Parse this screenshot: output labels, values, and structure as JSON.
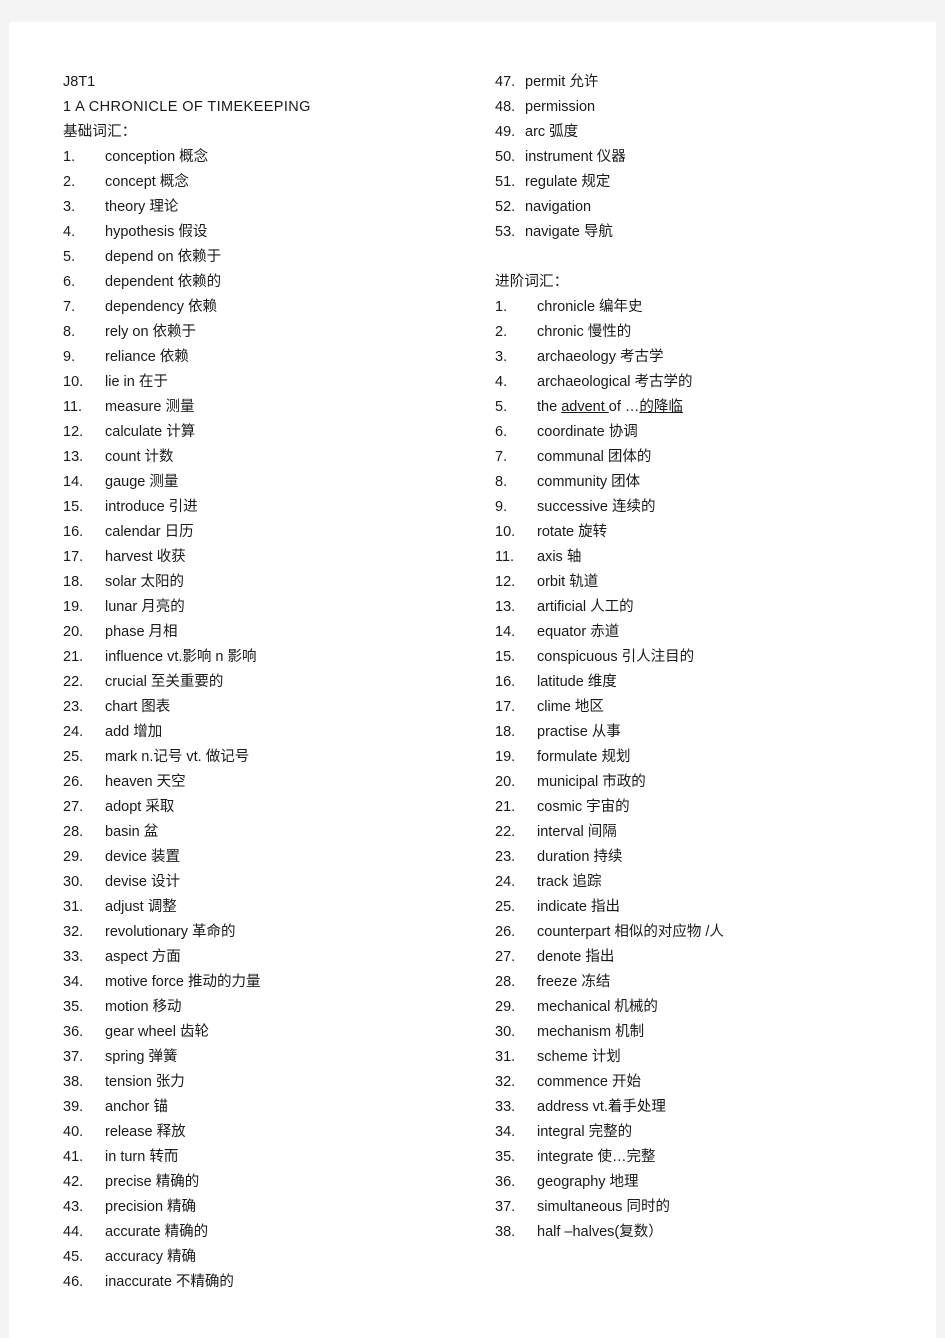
{
  "document": {
    "code": "J8T1",
    "title": "1 A CHRONICLE OF TIMEKEEPING"
  },
  "sections": {
    "basic": {
      "heading": "基础词汇：",
      "items": [
        {
          "n": "1.",
          "text": "conception   概念"
        },
        {
          "n": "2.",
          "text": "concept  概念"
        },
        {
          "n": "3.",
          "text": "theory   理论"
        },
        {
          "n": "4.",
          "text": "hypothesis   假设"
        },
        {
          "n": "5.",
          "text": "depend on  依赖于"
        },
        {
          "n": "6.",
          "text": "dependent  依赖的"
        },
        {
          "n": "7.",
          "text": "dependency  依赖"
        },
        {
          "n": "8.",
          "text": "rely on  依赖于"
        },
        {
          "n": "9.",
          "text": "reliance    依赖"
        },
        {
          "n": "10.",
          "text": "lie in   在于"
        },
        {
          "n": "11.",
          "text": "measure  测量"
        },
        {
          "n": "12.",
          "text": "calculate  计算"
        },
        {
          "n": "13.",
          "text": "count  计数"
        },
        {
          "n": "14.",
          "text": "gauge 测量"
        },
        {
          "n": "15.",
          "text": "introduce   引进"
        },
        {
          "n": "16.",
          "text": "calendar  日历"
        },
        {
          "n": "17.",
          "text": "harvest   收获"
        },
        {
          "n": "18.",
          "text": "solar  太阳的"
        },
        {
          "n": "19.",
          "text": "lunar    月亮的"
        },
        {
          "n": "20.",
          "text": "phase 月相"
        },
        {
          "n": "21.",
          "text": "influence    vt.影响  n 影响"
        },
        {
          "n": "22.",
          "text": "crucial  至关重要的"
        },
        {
          "n": "23.",
          "text": "chart  图表"
        },
        {
          "n": "24.",
          "text": "add 增加"
        },
        {
          "n": "25.",
          "text": "mark    n.记号    vt. 做记号"
        },
        {
          "n": "26.",
          "text": "heaven  天空"
        },
        {
          "n": "27.",
          "text": "adopt  采取"
        },
        {
          "n": "28.",
          "text": "basin  盆"
        },
        {
          "n": "29.",
          "text": "device  装置"
        },
        {
          "n": "30.",
          "text": "devise  设计"
        },
        {
          "n": "31.",
          "text": "adjust  调整"
        },
        {
          "n": "32.",
          "text": "revolutionary   革命的"
        },
        {
          "n": "33.",
          "text": "aspect  方面"
        },
        {
          "n": "34.",
          "text": "motive force   推动的力量"
        },
        {
          "n": "35.",
          "text": "motion   移动"
        },
        {
          "n": "36.",
          "text": "gear wheel  齿轮"
        },
        {
          "n": "37.",
          "text": "spring 弹簧"
        },
        {
          "n": "38.",
          "text": "tension   张力"
        },
        {
          "n": "39.",
          "text": "anchor    锚"
        },
        {
          "n": "40.",
          "text": "release 释放"
        },
        {
          "n": "41.",
          "text": "in turn  转而"
        },
        {
          "n": "42.",
          "text": "precise 精确的"
        },
        {
          "n": "43.",
          "text": "precision  精确"
        },
        {
          "n": "44.",
          "text": "accurate 精确的"
        },
        {
          "n": "45.",
          "text": "accuracy 精确"
        },
        {
          "n": "46.",
          "text": "inaccurate  不精确的"
        }
      ],
      "continued": [
        {
          "n": "47.",
          "text": "permit  允许"
        },
        {
          "n": "48.",
          "text": "permission"
        },
        {
          "n": "49.",
          "text": "arc 弧度"
        },
        {
          "n": "50.",
          "text": "instrument  仪器"
        },
        {
          "n": "51.",
          "text": "regulate  规定"
        },
        {
          "n": "52.",
          "text": "navigation"
        },
        {
          "n": "53.",
          "text": "navigate 导航"
        }
      ]
    },
    "advanced": {
      "heading": "进阶词汇：",
      "items": [
        {
          "n": "1.",
          "text": "chronicle   编年史"
        },
        {
          "n": "2.",
          "text": "chronic  慢性的"
        },
        {
          "n": "3.",
          "text": "archaeology   考古学"
        },
        {
          "n": "4.",
          "text": "archaeological  考古学的"
        },
        {
          "n": "5.",
          "parts": [
            {
              "t": "the ",
              "u": false
            },
            {
              "t": "advent ",
              "u": true
            },
            {
              "t": "of   ",
              "u": false
            },
            {
              "t": "…",
              "u": false
            },
            {
              "t": "的降临",
              "u": true
            }
          ]
        },
        {
          "n": "6.",
          "text": "coordinate  协调"
        },
        {
          "n": "7.",
          "text": "communal  团体的"
        },
        {
          "n": "8.",
          "text": "community  团体"
        },
        {
          "n": "9.",
          "text": "successive 连续的"
        },
        {
          "n": "10.",
          "text": "rotate   旋转"
        },
        {
          "n": "11.",
          "text": "axis 轴"
        },
        {
          "n": "12.",
          "text": "orbit  轨道"
        },
        {
          "n": "13.",
          "text": "artificial  人工的"
        },
        {
          "n": "14.",
          "text": "equator  赤道"
        },
        {
          "n": "15.",
          "text": "conspicuous   引人注目的"
        },
        {
          "n": "16.",
          "text": "latitude  维度"
        },
        {
          "n": "17.",
          "text": "clime  地区"
        },
        {
          "n": "18.",
          "text": "practise 从事"
        },
        {
          "n": "19.",
          "text": "formulate   规划"
        },
        {
          "n": "20.",
          "text": "municipal   市政的"
        },
        {
          "n": "21.",
          "text": "cosmic 宇宙的"
        },
        {
          "n": "22.",
          "text": "interval  间隔"
        },
        {
          "n": "23.",
          "text": "duration  持续"
        },
        {
          "n": "24.",
          "text": "track  追踪"
        },
        {
          "n": "25.",
          "text": "indicate 指出"
        },
        {
          "n": "26.",
          "text": "counterpart   相似的对应物  /人"
        },
        {
          "n": "27.",
          "text": "denote  指出"
        },
        {
          "n": "28.",
          "text": "freeze 冻结"
        },
        {
          "n": "29.",
          "text": "mechanical  机械的"
        },
        {
          "n": "30.",
          "text": "mechanism  机制"
        },
        {
          "n": "31.",
          "text": "scheme  计划"
        },
        {
          "n": "32.",
          "text": "commence  开始"
        },
        {
          "n": "33.",
          "text": "address   vt.着手处理"
        },
        {
          "n": "34.",
          "text": "integral  完整的"
        },
        {
          "n": "35.",
          "text": "integrate  使…完整"
        },
        {
          "n": "36.",
          "text": "geography  地理"
        },
        {
          "n": "37.",
          "text": "simultaneous   同时的"
        },
        {
          "n": "38.",
          "text": "half –halves(复数）"
        }
      ]
    }
  }
}
